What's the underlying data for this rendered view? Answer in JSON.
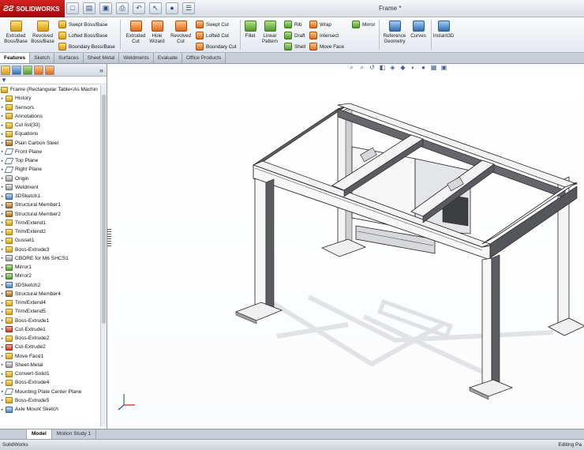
{
  "app": {
    "logo": "SOLIDWORKS",
    "window_title": "Frame *"
  },
  "ribbon": {
    "big_buttons": [
      "Extruded Boss/Base",
      "Revolved Boss/Base",
      "Extruded Cut",
      "Hole Wizard",
      "Revolved Cut",
      "Fillet",
      "Linear Pattern",
      "Reference Geometry",
      "Curves",
      "Instant3D"
    ],
    "small_buttons": [
      "Swept Boss/Base",
      "Lofted Boss/Base",
      "Boundary Boss/Base",
      "Swept Cut",
      "Lofted Cut",
      "Boundary Cut",
      "Rib",
      "Draft",
      "Shell",
      "Wrap",
      "Intersect",
      "Move Face",
      "Mirror"
    ]
  },
  "tabs": [
    "Features",
    "Sketch",
    "Surfaces",
    "Sheet Metal",
    "Weldments",
    "Evaluate",
    "Office Products"
  ],
  "active_tab": "Features",
  "tree": {
    "root": "Frame  (Rectangular Table<As Machin",
    "items": [
      {
        "label": "History",
        "icon": "history-icon"
      },
      {
        "label": "Sensors",
        "icon": "sensors-icon"
      },
      {
        "label": "Annotations",
        "icon": "annotations-icon"
      },
      {
        "label": "Cut list(33)",
        "icon": "cut-list-icon"
      },
      {
        "label": "Equations",
        "icon": "equations-icon"
      },
      {
        "label": "Plain Carbon Steel",
        "icon": "material-icon"
      },
      {
        "label": "Front Plane",
        "icon": "plane-icon"
      },
      {
        "label": "Top Plane",
        "icon": "plane-icon"
      },
      {
        "label": "Right Plane",
        "icon": "plane-icon"
      },
      {
        "label": "Origin",
        "icon": "origin-icon"
      },
      {
        "label": "Weldment",
        "icon": "weldment-icon"
      },
      {
        "label": "3DSketch1",
        "icon": "sketch-icon"
      },
      {
        "label": "Structural Member1",
        "icon": "structural-member-icon"
      },
      {
        "label": "Structural Member2",
        "icon": "structural-member-icon"
      },
      {
        "label": "Trim/Extend1",
        "icon": "trim-icon"
      },
      {
        "label": "Trim/Extend2",
        "icon": "trim-icon"
      },
      {
        "label": "Gusset1",
        "icon": "gusset-icon"
      },
      {
        "label": "Boss-Extrude3",
        "icon": "extrude-icon"
      },
      {
        "label": "CBORE for M6 SHCS1",
        "icon": "hole-icon"
      },
      {
        "label": "Mirror1",
        "icon": "mirror-icon"
      },
      {
        "label": "Mirror2",
        "icon": "mirror-icon"
      },
      {
        "label": "3DSketch2",
        "icon": "sketch-icon"
      },
      {
        "label": "Structural Member4",
        "icon": "structural-member-icon"
      },
      {
        "label": "Trim/Extend4",
        "icon": "trim-icon"
      },
      {
        "label": "Trim/Extend5",
        "icon": "trim-icon"
      },
      {
        "label": "Boss-Extrude1",
        "icon": "extrude-icon"
      },
      {
        "label": "Cut-Extrude1",
        "icon": "cut-icon"
      },
      {
        "label": "Boss-Extrude2",
        "icon": "extrude-icon"
      },
      {
        "label": "Cut-Extrude2",
        "icon": "cut-icon"
      },
      {
        "label": "Move Face1",
        "icon": "move-face-icon"
      },
      {
        "label": "Sheet-Metal",
        "icon": "sheet-metal-icon"
      },
      {
        "label": "Convert-Solid1",
        "icon": "convert-icon"
      },
      {
        "label": "Boss-Extrude4",
        "icon": "extrude-icon"
      },
      {
        "label": "Mounting Plate Center Plane",
        "icon": "plane-icon"
      },
      {
        "label": "Boss-Extrude5",
        "icon": "extrude-icon"
      },
      {
        "label": "Axle Mount Sketch",
        "icon": "sketch-icon"
      }
    ]
  },
  "bottom_tabs": [
    "Model",
    "Motion Study 1"
  ],
  "status": {
    "left": "SolidWorks",
    "right": "Editing Pa"
  }
}
